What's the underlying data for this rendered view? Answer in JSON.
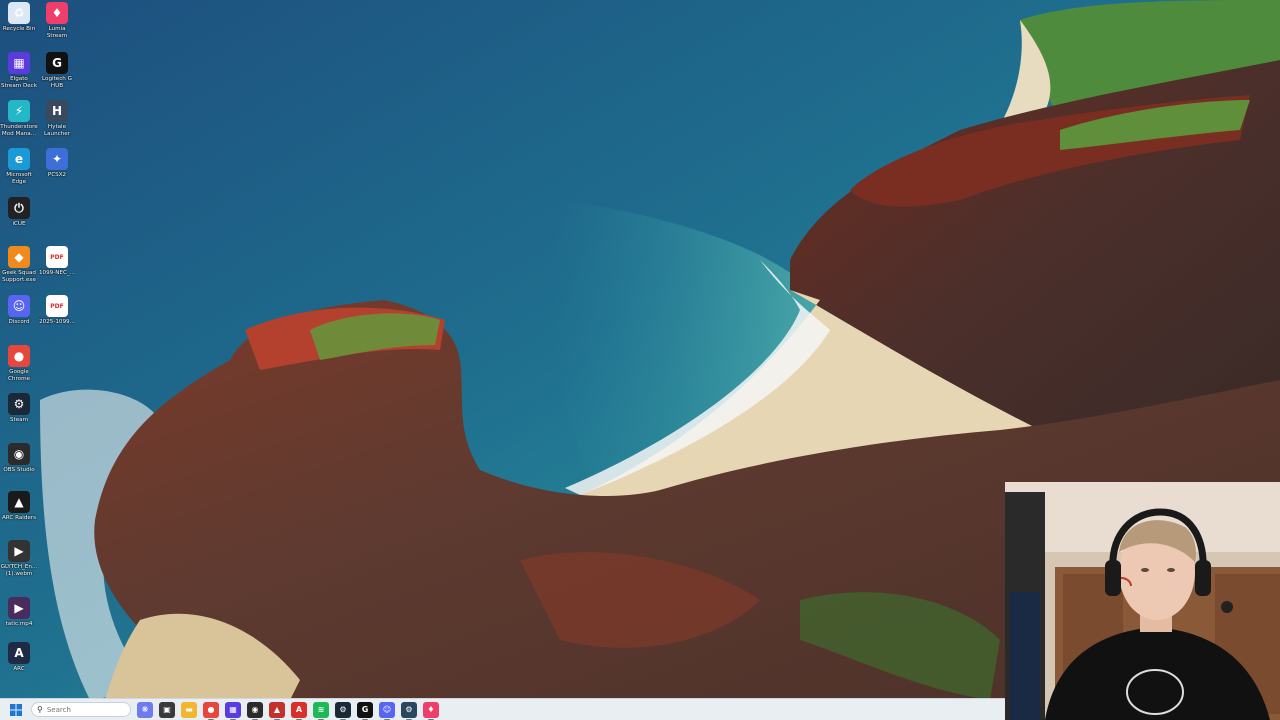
{
  "desktop": {
    "icons": [
      {
        "name": "recycle-bin",
        "label": "Recycle Bin",
        "icon": "recycle-bin-icon",
        "color": "#dce8f4"
      },
      {
        "name": "lumia-stream",
        "label": "Lumia Stream",
        "icon": "map-pin-icon",
        "color": "#ef3e6a"
      },
      {
        "name": "elgato-stream-deck",
        "label": "Elgato Stream Deck",
        "icon": "grid-icon",
        "color": "#5b3be0"
      },
      {
        "name": "logitech-g-hub",
        "label": "Logitech G HUB",
        "icon": "logitech-g-icon",
        "color": "#111111"
      },
      {
        "name": "thunderstore",
        "label": "Thunderstore Mod Mana...",
        "icon": "thunderstore-icon",
        "color": "#23b7c8"
      },
      {
        "name": "hytale-launcher",
        "label": "Hytale Launcher",
        "icon": "hytale-icon",
        "color": "#3a4a5e"
      },
      {
        "name": "microsoft-edge",
        "label": "Microsoft Edge",
        "icon": "edge-icon",
        "color": "#1c9ad6"
      },
      {
        "name": "pcsx2",
        "label": "PCSX2",
        "icon": "pcsx2-icon",
        "color": "#3c6fd8"
      },
      {
        "name": "icue",
        "label": "iCUE",
        "icon": "icue-icon",
        "color": "#222222"
      },
      {
        "name": "geek-squad",
        "label": "Geek Squad Support.exe",
        "icon": "geek-squad-icon",
        "color": "#f08a1c"
      },
      {
        "name": "pdf-1099-nec",
        "label": "1099-NEC_...",
        "icon": "pdf-icon",
        "color": "#d92b2b"
      },
      {
        "name": "discord",
        "label": "Discord",
        "icon": "discord-icon",
        "color": "#5865f2"
      },
      {
        "name": "pdf-2025-1099",
        "label": "2025-1099...",
        "icon": "pdf-icon",
        "color": "#d92b2b"
      },
      {
        "name": "google-chrome",
        "label": "Google Chrome",
        "icon": "chrome-icon",
        "color": "#e8453c"
      },
      {
        "name": "steam",
        "label": "Steam",
        "icon": "steam-icon",
        "color": "#1b2838"
      },
      {
        "name": "obs-studio",
        "label": "OBS Studio",
        "icon": "obs-icon",
        "color": "#2b2b2b"
      },
      {
        "name": "arc-raiders",
        "label": "ARC Raiders",
        "icon": "arc-raiders-icon",
        "color": "#1a1a1a"
      },
      {
        "name": "glytch-video",
        "label": "GLYTCH_En... (1).webm",
        "icon": "video-file-icon",
        "color": "#333333"
      },
      {
        "name": "tatic-video",
        "label": "tatic.mp4",
        "icon": "video-file-icon",
        "color": "#4a2b5e"
      },
      {
        "name": "arc",
        "label": "ARC",
        "icon": "arc-icon",
        "color": "#202a44"
      }
    ]
  },
  "taskbar": {
    "search_placeholder": "Search",
    "apps": [
      {
        "name": "copilot",
        "icon": "copilot-icon",
        "color": "#6f7cf0",
        "glyph": "❋"
      },
      {
        "name": "task-view",
        "icon": "task-view-icon",
        "color": "#3a3a3a",
        "glyph": "▣"
      },
      {
        "name": "file-explorer",
        "icon": "folder-icon",
        "color": "#f2b632",
        "glyph": "▬"
      },
      {
        "name": "chrome",
        "icon": "chrome-icon",
        "color": "#e8453c",
        "glyph": "●"
      },
      {
        "name": "stream-deck",
        "icon": "grid-icon",
        "color": "#5b3be0",
        "glyph": "▦"
      },
      {
        "name": "obs",
        "icon": "obs-icon",
        "color": "#2b2b2b",
        "glyph": "◉"
      },
      {
        "name": "arc-raiders",
        "icon": "arc-raiders-icon",
        "color": "#c4302b",
        "glyph": "▲"
      },
      {
        "name": "adobe",
        "icon": "adobe-icon",
        "color": "#d9312a",
        "glyph": "A"
      },
      {
        "name": "spotify",
        "icon": "spotify-icon",
        "color": "#1db954",
        "glyph": "≋"
      },
      {
        "name": "steam",
        "icon": "steam-icon",
        "color": "#1b2838",
        "glyph": "⚙"
      },
      {
        "name": "logitech-g-hub",
        "icon": "logitech-g-icon",
        "color": "#111111",
        "glyph": "G"
      },
      {
        "name": "discord",
        "icon": "discord-icon",
        "color": "#5865f2",
        "glyph": "☺"
      },
      {
        "name": "steam-2",
        "icon": "steam-icon",
        "color": "#2a475e",
        "glyph": "⚙"
      },
      {
        "name": "lumia-stream",
        "icon": "map-pin-icon",
        "color": "#ef3e6a",
        "glyph": "♦"
      }
    ]
  }
}
